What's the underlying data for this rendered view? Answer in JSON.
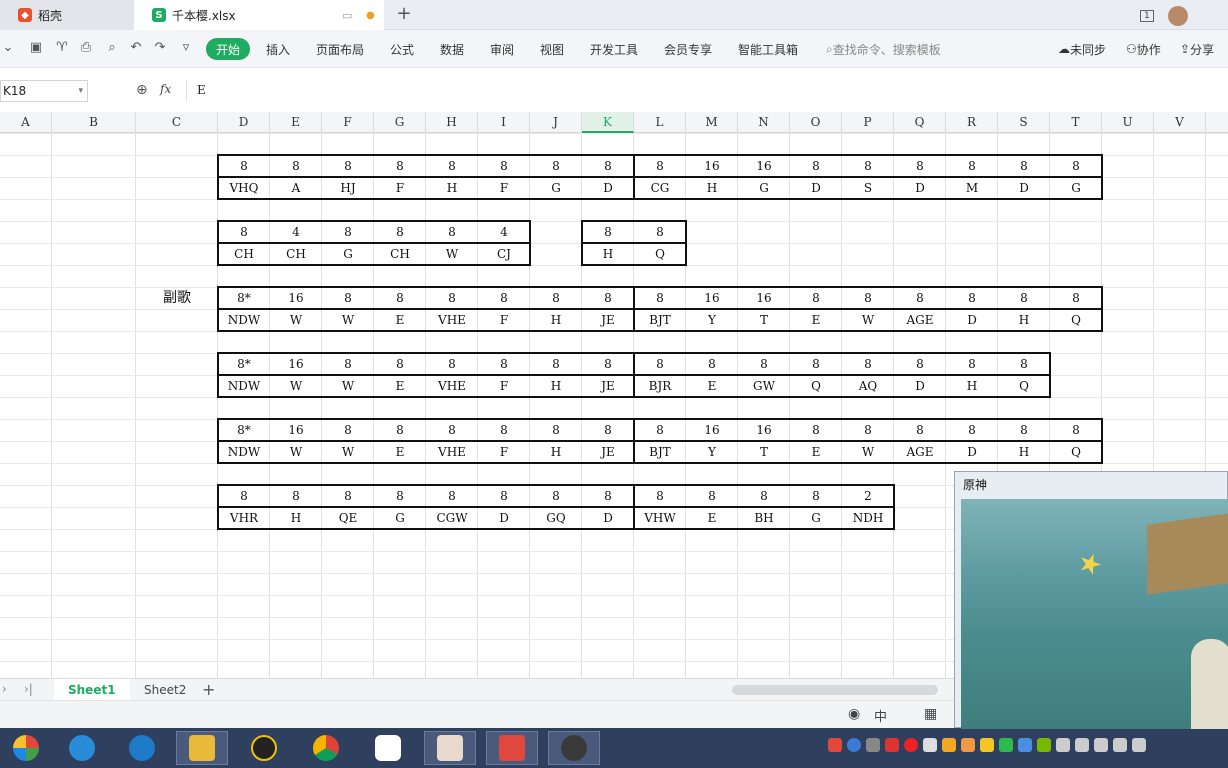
{
  "tabs": {
    "daoke": "稻壳",
    "file": "千本樱.xlsx"
  },
  "ribbon": {
    "items": [
      "开始",
      "插入",
      "页面布局",
      "公式",
      "数据",
      "审阅",
      "视图",
      "开发工具",
      "会员专享",
      "智能工具箱"
    ],
    "search": "查找命令、搜索模板",
    "sync": "未同步",
    "collab": "协作",
    "share": "分享"
  },
  "formula": {
    "namebox": "K18",
    "fx": "fx",
    "value": "E"
  },
  "columns": [
    "A",
    "B",
    "C",
    "D",
    "E",
    "F",
    "G",
    "H",
    "I",
    "J",
    "K",
    "L",
    "M",
    "N",
    "O",
    "P",
    "Q",
    "R",
    "S",
    "T",
    "U",
    "V"
  ],
  "selected_column": "K",
  "section_label": "副歌",
  "blocks": [
    {
      "row_top": [
        "8",
        "8",
        "8",
        "8",
        "8",
        "8",
        "8",
        "8",
        "8",
        "16",
        "16",
        "8",
        "8",
        "8",
        "8",
        "8",
        "8"
      ],
      "row_bottom": [
        "VHQ",
        "A",
        "HJ",
        "F",
        "H",
        "F",
        "G",
        "D",
        "CG",
        "H",
        "G",
        "D",
        "S",
        "D",
        "M",
        "D",
        "G"
      ]
    },
    {
      "row_top": [
        "8",
        "4",
        "8",
        "8",
        "8",
        "4",
        "",
        "8",
        "8"
      ],
      "row_bottom": [
        "CH",
        "CH",
        "G",
        "CH",
        "W",
        "CJ",
        "",
        "H",
        "Q"
      ]
    },
    {
      "row_top": [
        "8*",
        "16",
        "8",
        "8",
        "8",
        "8",
        "8",
        "8",
        "8",
        "16",
        "16",
        "8",
        "8",
        "8",
        "8",
        "8",
        "8"
      ],
      "row_bottom": [
        "NDW",
        "W",
        "W",
        "E",
        "VHE",
        "F",
        "H",
        "JE",
        "BJT",
        "Y",
        "T",
        "E",
        "W",
        "AGE",
        "D",
        "H",
        "Q"
      ]
    },
    {
      "row_top": [
        "8*",
        "16",
        "8",
        "8",
        "8",
        "8",
        "8",
        "8",
        "8",
        "8",
        "8",
        "8",
        "8",
        "8",
        "8",
        "8"
      ],
      "row_bottom": [
        "NDW",
        "W",
        "W",
        "E",
        "VHE",
        "F",
        "H",
        "JE",
        "BJR",
        "E",
        "GW",
        "Q",
        "AQ",
        "D",
        "H",
        "Q"
      ]
    },
    {
      "row_top": [
        "8*",
        "16",
        "8",
        "8",
        "8",
        "8",
        "8",
        "8",
        "8",
        "16",
        "16",
        "8",
        "8",
        "8",
        "8",
        "8",
        "8"
      ],
      "row_bottom": [
        "NDW",
        "W",
        "W",
        "E",
        "VHE",
        "F",
        "H",
        "JE",
        "BJT",
        "Y",
        "T",
        "E",
        "W",
        "AGE",
        "D",
        "H",
        "Q"
      ]
    },
    {
      "row_top": [
        "8",
        "8",
        "8",
        "8",
        "8",
        "8",
        "8",
        "8",
        "8",
        "8",
        "8",
        "8",
        "2"
      ],
      "row_bottom": [
        "VHR",
        "H",
        "QE",
        "G",
        "CGW",
        "D",
        "GQ",
        "D",
        "VHW",
        "E",
        "BH",
        "G",
        "NDH"
      ]
    }
  ],
  "sheets": [
    "Sheet1",
    "Sheet2"
  ],
  "game_window": {
    "title": "原神"
  },
  "colors": {
    "accent": "#1fab61",
    "taskbar": "#2f3f5e"
  }
}
